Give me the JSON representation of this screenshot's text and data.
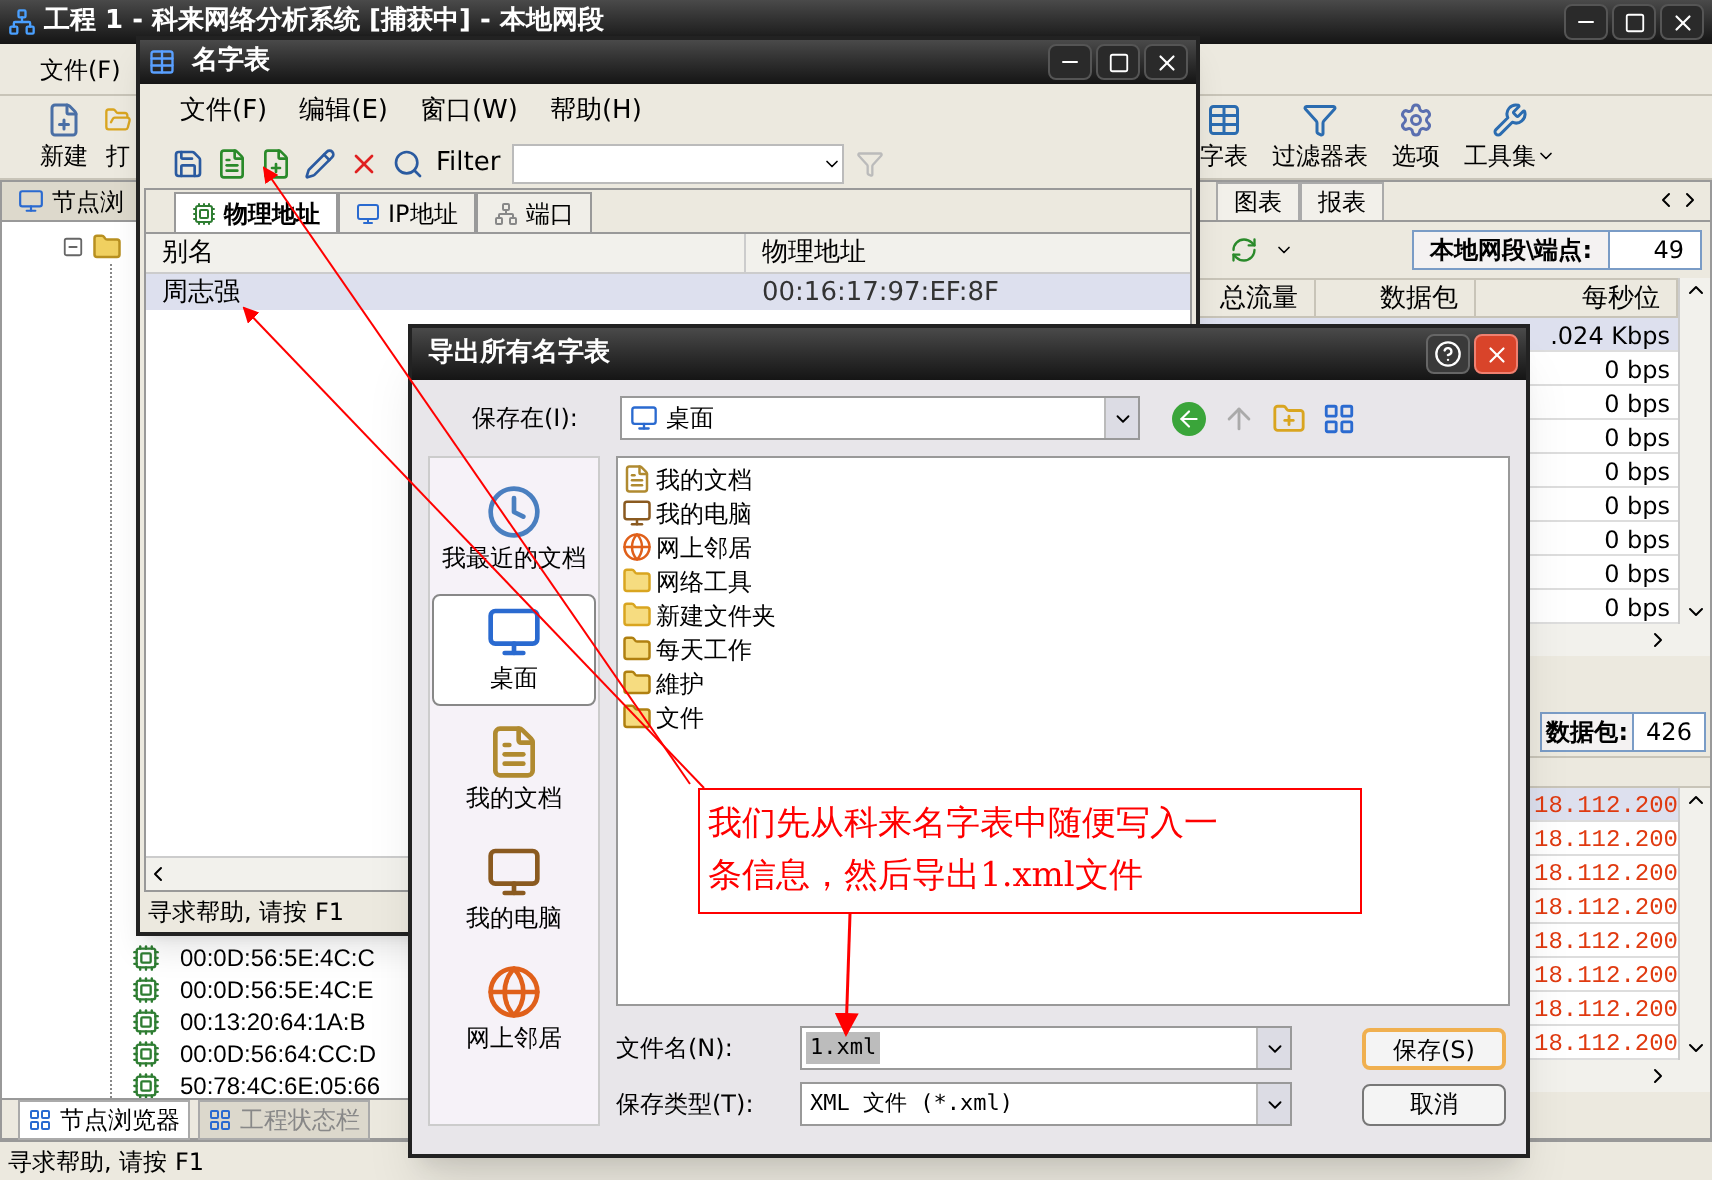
{
  "main_window": {
    "title": "工程 1 - 科来网络分析系统 [捕获中] - 本地网段",
    "menu": [
      "文件(F)"
    ],
    "toolbar_left": [
      {
        "label": "新建",
        "kind": "new"
      },
      {
        "label": "打",
        "kind": "open"
      }
    ],
    "toolbar_right": [
      {
        "label": "字表",
        "kind": "table"
      },
      {
        "label": "过滤器表",
        "kind": "filter"
      },
      {
        "label": "选项",
        "kind": "options"
      },
      {
        "label": "工具集",
        "kind": "tools"
      }
    ],
    "left_pane": {
      "header": "节点浏",
      "tree": {
        "expanded": true,
        "children": [
          {
            "label": "00:0D:56:5E:4C:C"
          },
          {
            "label": "00:0D:56:5E:4C:E"
          },
          {
            "label": "00:13:20:64:1A:B"
          },
          {
            "label": "00:0D:56:64:CC:D"
          },
          {
            "label": "50:78:4C:6E:05:66"
          }
        ]
      },
      "bottom_tabs": [
        {
          "label": "节点浏览器",
          "selected": true
        },
        {
          "label": "工程状态栏",
          "selected": false
        }
      ]
    },
    "right_pane": {
      "tabs": [
        "图表",
        "报表"
      ],
      "segment_label": "本地网段\\端点:",
      "segment_value": "49",
      "columns": [
        "总流量",
        "数据包",
        "每秒位"
      ],
      "rows": [
        {
          "rate": ".024 Kbps",
          "selected": true
        },
        {
          "rate": "0 bps",
          "selected": false
        },
        {
          "rate": "0 bps",
          "selected": false
        },
        {
          "rate": "0 bps",
          "selected": false
        },
        {
          "rate": "0 bps",
          "selected": false
        },
        {
          "rate": "0 bps",
          "selected": false
        },
        {
          "rate": "0 bps",
          "selected": false
        },
        {
          "rate": "0 bps",
          "selected": false
        },
        {
          "rate": "0 bps",
          "selected": false
        }
      ],
      "packets_label": "数据包:",
      "packets_value": "426",
      "address_rows": [
        {
          "address": "18.112.200",
          "selected": true
        },
        {
          "address": "18.112.200",
          "selected": false
        },
        {
          "address": "18.112.200",
          "selected": false
        },
        {
          "address": "18.112.200",
          "selected": false
        },
        {
          "address": "18.112.200",
          "selected": false
        },
        {
          "address": "18.112.200",
          "selected": false
        },
        {
          "address": "18.112.200",
          "selected": false
        },
        {
          "address": "18.112.200",
          "selected": false
        }
      ]
    },
    "status_bar": "寻求帮助, 请按 F1"
  },
  "name_table_window": {
    "title": "名字表",
    "menu": [
      "文件(F)",
      "编辑(E)",
      "窗口(W)",
      "帮助(H)"
    ],
    "filter_label": "Filter",
    "tabs": [
      {
        "label": "物理地址",
        "selected": true
      },
      {
        "label": "IP地址",
        "selected": false
      },
      {
        "label": "端口",
        "selected": false
      }
    ],
    "columns": [
      "别名",
      "物理地址"
    ],
    "rows": [
      {
        "alias": "周志强",
        "mac": "00:16:17:97:EF:8F",
        "selected": true
      }
    ],
    "status_bar": "寻求帮助, 请按 F1"
  },
  "export_dialog": {
    "title": "导出所有名字表",
    "save_in_label": "保存在(I):",
    "save_in_value": "桌面",
    "places": [
      {
        "label": "我最近的文档",
        "kind": "recent",
        "selected": false
      },
      {
        "label": "桌面",
        "kind": "desktop",
        "selected": true
      },
      {
        "label": "我的文档",
        "kind": "documents",
        "selected": false
      },
      {
        "label": "我的电脑",
        "kind": "computer",
        "selected": false
      },
      {
        "label": "网上邻居",
        "kind": "network",
        "selected": false
      }
    ],
    "files": [
      {
        "name": "我的文档",
        "kind": "documents"
      },
      {
        "name": "我的电脑",
        "kind": "computer"
      },
      {
        "name": "网上邻居",
        "kind": "network"
      },
      {
        "name": "网络工具",
        "kind": "folder"
      },
      {
        "name": "新建文件夹",
        "kind": "folder"
      },
      {
        "name": "每天工作",
        "kind": "shortcut"
      },
      {
        "name": "維护",
        "kind": "shortcut"
      },
      {
        "name": "文件",
        "kind": "shortcut"
      }
    ],
    "filename_label": "文件名(N):",
    "filename_value": "1.xml",
    "filetype_label": "保存类型(T):",
    "filetype_value": "XML 文件 (*.xml)",
    "buttons": [
      "保存(S)",
      "取消"
    ]
  },
  "annotation": {
    "lines": [
      "我们先从科来名字表中随便写入一",
      "条信息，然后导出1.xml文件"
    ]
  }
}
